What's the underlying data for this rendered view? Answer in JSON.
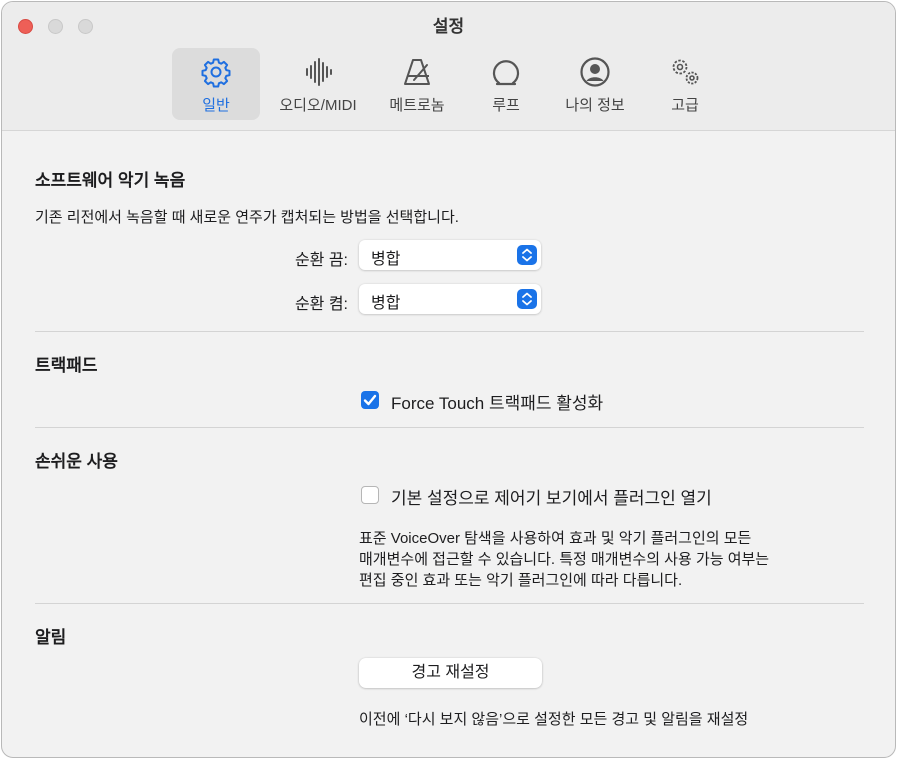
{
  "window": {
    "title": "설정"
  },
  "tabs": [
    {
      "label": "일반",
      "icon": "gear-icon",
      "active": true
    },
    {
      "label": "오디오/MIDI",
      "icon": "waveform-icon",
      "active": false
    },
    {
      "label": "메트로놈",
      "icon": "metronome-icon",
      "active": false
    },
    {
      "label": "루프",
      "icon": "loop-icon",
      "active": false
    },
    {
      "label": "나의 정보",
      "icon": "person-circle-icon",
      "active": false
    },
    {
      "label": "고급",
      "icon": "gears-icon",
      "active": false
    }
  ],
  "software_recording": {
    "heading": "소프트웨어 악기 녹음",
    "description": "기존 리전에서 녹음할 때 새로운 연주가 캡처되는 방법을 선택합니다.",
    "cycle_off_label": "순환 끔:",
    "cycle_off_value": "병합",
    "cycle_on_label": "순환 켬:",
    "cycle_on_value": "병합"
  },
  "trackpad": {
    "heading": "트랙패드",
    "force_touch_label": "Force Touch 트랙패드 활성화",
    "force_touch_checked": true
  },
  "accessibility": {
    "heading": "손쉬운 사용",
    "plugin_option_label": "기본 설정으로 제어기 보기에서 플러그인 열기",
    "plugin_option_checked": false,
    "desc_line1": "표준 VoiceOver 탐색을 사용하여 효과 및 악기 플러그인의 모든",
    "desc_line2": "매개변수에 접근할 수 있습니다. 특정 매개변수의 사용 가능 여부는",
    "desc_line3": "편집 중인 효과 또는 악기 플러그인에 따라 다릅니다."
  },
  "alerts": {
    "heading": "알림",
    "reset_button": "경고 재설정",
    "description": "이전에 ‘다시 보지 않음’으로 설정한 모든 경고 및 알림을 재설정"
  },
  "colors": {
    "accent": "#1a73e8",
    "close": "#ee5f57"
  }
}
